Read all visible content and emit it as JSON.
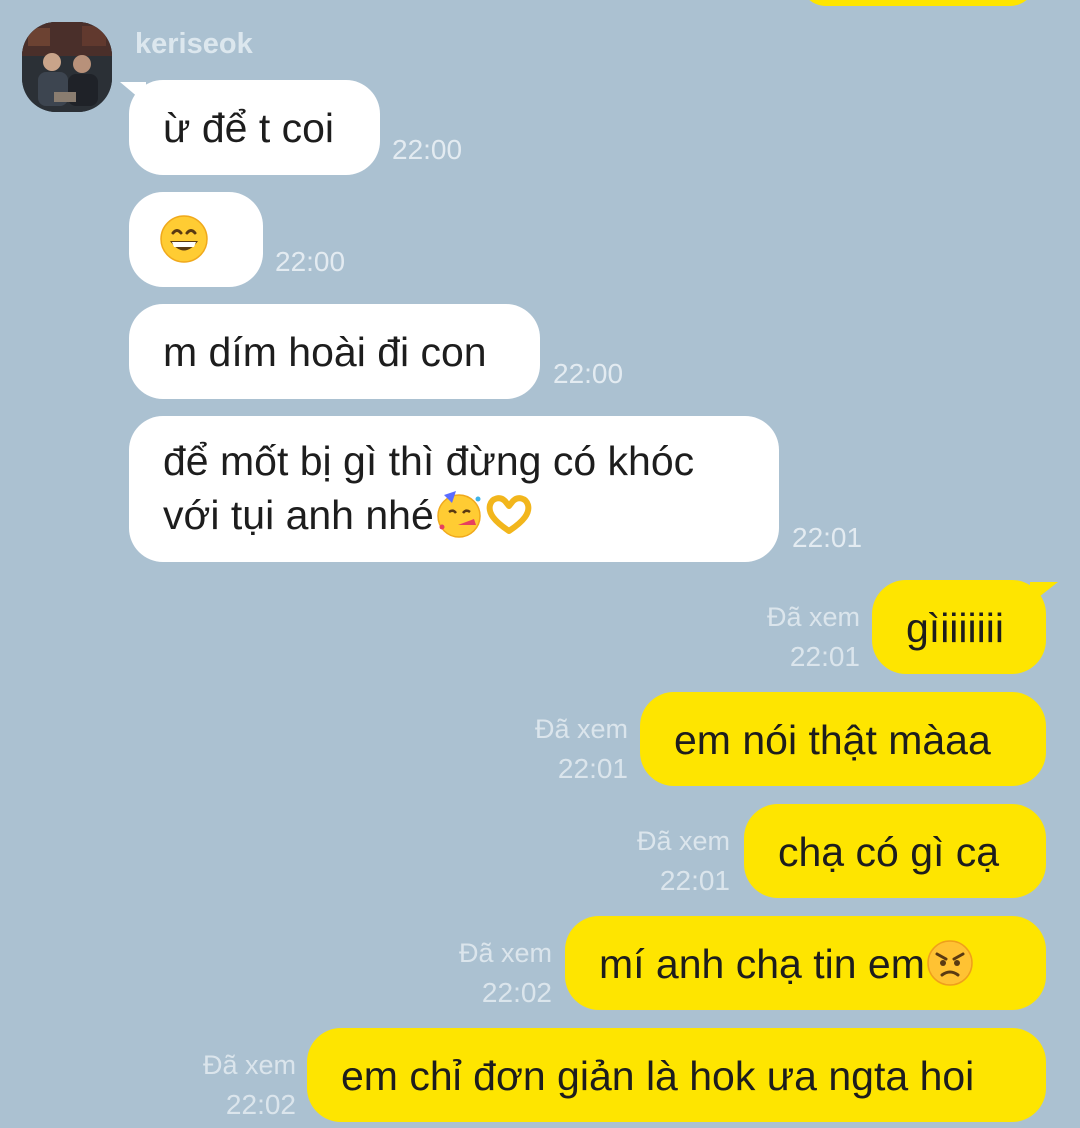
{
  "sender": {
    "name": "keriseok"
  },
  "incoming": [
    {
      "text": "ừ để t coi",
      "time": "22:00"
    },
    {
      "emoji": "grinning-face",
      "time": "22:00"
    },
    {
      "text": "m dím hoài đi con",
      "time": "22:00"
    },
    {
      "line1": "để mốt bị gì thì đừng có khóc",
      "line2": "với tụi anh nhé",
      "time": "22:01"
    }
  ],
  "outgoing": [
    {
      "text": "gìiiiiiii",
      "seen": "Đã xem",
      "time": "22:01"
    },
    {
      "text": "em nói thật màaa",
      "seen": "Đã xem",
      "time": "22:01"
    },
    {
      "text": "chạ có gì cạ",
      "seen": "Đã xem",
      "time": "22:01"
    },
    {
      "text": "mí anh chạ tin em",
      "seen": "Đã xem",
      "time": "22:02"
    },
    {
      "text": "em chỉ đơn giản là hok ưa ngta hoi",
      "seen": "Đã xem",
      "time": "22:02"
    }
  ],
  "colors": {
    "background": "#abc1d1",
    "incoming_bubble": "#ffffff",
    "outgoing_bubble": "#fee500"
  }
}
